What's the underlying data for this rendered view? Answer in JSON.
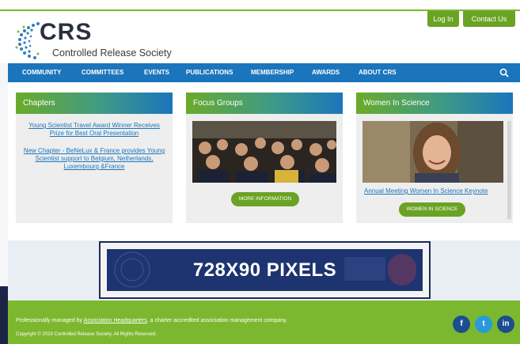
{
  "top_band_text": "",
  "header": {
    "logo_text": "CRS",
    "org_name": "Controlled Release Society",
    "login_label": "Log In",
    "contact_label": "Contact Us"
  },
  "nav": {
    "items": [
      "COMMUNITY",
      "COMMITTEES",
      "EVENTS",
      "PUBLICATIONS",
      "MEMBERSHIP",
      "AWARDS",
      "ABOUT CRS"
    ],
    "search_icon": "search-icon",
    "color": "#1b75bc"
  },
  "cards": {
    "chapters": {
      "title": "Chapters",
      "links": [
        "Young Scientist Travel Award Winner Receives Prize for Best Oral Presentation",
        "New Chapter - BeNeLux & France provides Young Scientist support to Belgium, Netherlands, Luxembourg &France"
      ]
    },
    "focus": {
      "title": "Focus Groups",
      "button": "MORE INFORMATION"
    },
    "women": {
      "title": "Women In Science",
      "link": "Annual Meeting Women In Science Keynote",
      "button": "WOMEN IN SCIENCE"
    }
  },
  "ad": {
    "label": "728X90 PIXELS"
  },
  "footer": {
    "managed_prefix": "Professionally managed by ",
    "managed_link": "Association Headquarters",
    "managed_suffix": ", a charter accredited association management company.",
    "copyright": "Copyright © 2019 Controlled Release Society. All Rights Reserved.",
    "social": [
      "f",
      "t",
      "in"
    ]
  },
  "colors": {
    "accent_green": "#6aa324",
    "brand_blue": "#1b75bc",
    "footer_green": "#7cb82f"
  }
}
